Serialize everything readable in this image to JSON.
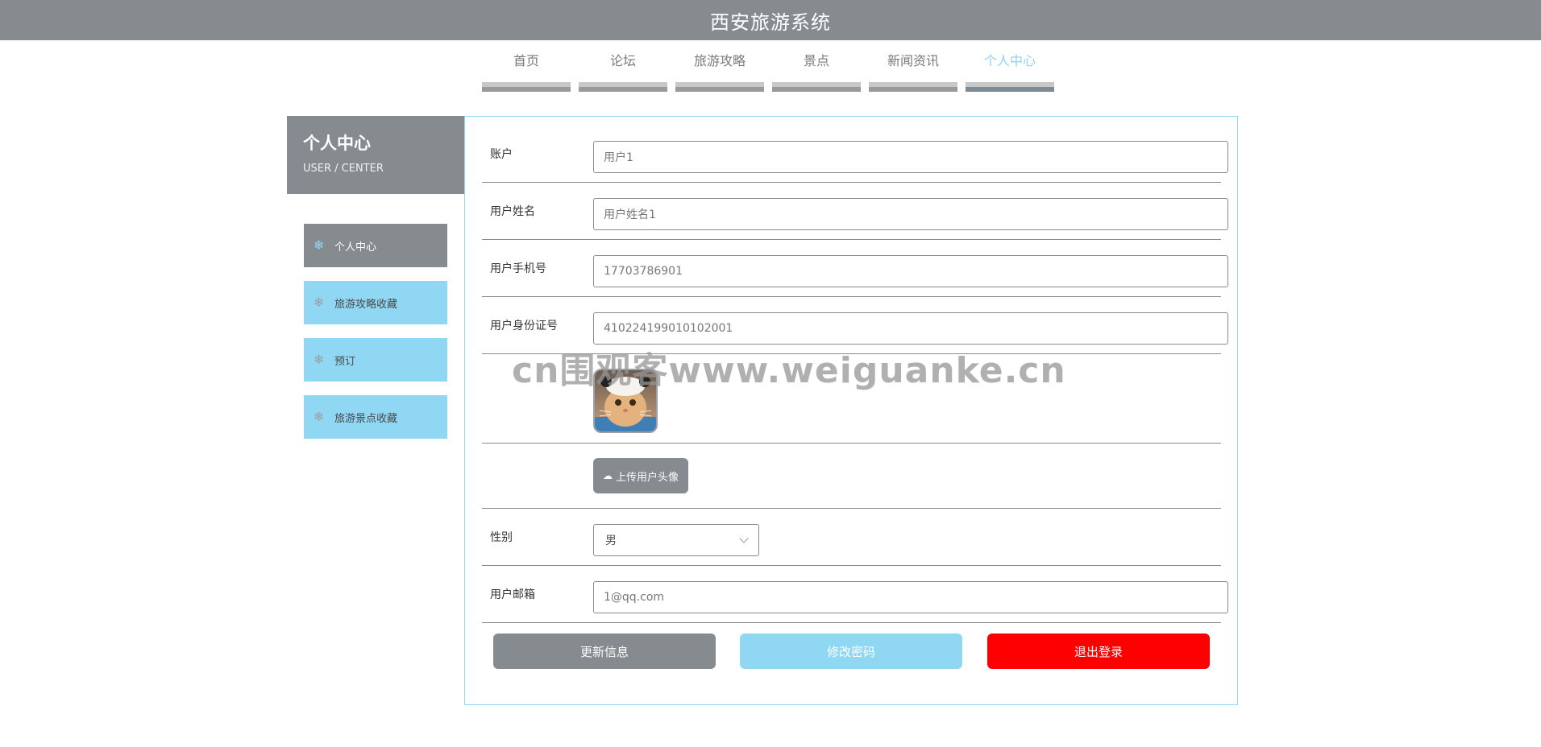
{
  "header": {
    "title": "西安旅游系统"
  },
  "nav": {
    "items": [
      {
        "label": "首页"
      },
      {
        "label": "论坛"
      },
      {
        "label": "旅游攻略"
      },
      {
        "label": "景点"
      },
      {
        "label": "新闻资讯"
      },
      {
        "label": "个人中心",
        "active": true
      }
    ]
  },
  "sidebar": {
    "title": "个人中心",
    "subtitle": "USER / CENTER",
    "items": [
      {
        "label": "个人中心",
        "active": true,
        "icon": "snowflake-icon"
      },
      {
        "label": "旅游攻略收藏",
        "icon": "snowflake-icon"
      },
      {
        "label": "预订",
        "icon": "snowflake-icon"
      },
      {
        "label": "旅游景点收藏",
        "icon": "snowflake-icon"
      }
    ]
  },
  "form": {
    "account": {
      "label": "账户",
      "value": "用户1"
    },
    "name": {
      "label": "用户姓名",
      "value": "用户姓名1"
    },
    "phone": {
      "label": "用户手机号",
      "value": "17703786901"
    },
    "id_card": {
      "label": "用户身份证号",
      "value": "410224199010102001"
    },
    "upload_label": "上传用户头像",
    "gender": {
      "label": "性别",
      "value": "男"
    },
    "email": {
      "label": "用户邮箱",
      "value": "1@qq.com"
    }
  },
  "actions": {
    "update": "更新信息",
    "change_password": "修改密码",
    "logout": "退出登录"
  },
  "watermark": "cn围观客www.weiguanke.cn",
  "colors": {
    "header_bg": "#858b8f",
    "accent_blue": "#8fd7f3",
    "danger": "#ff0000"
  }
}
